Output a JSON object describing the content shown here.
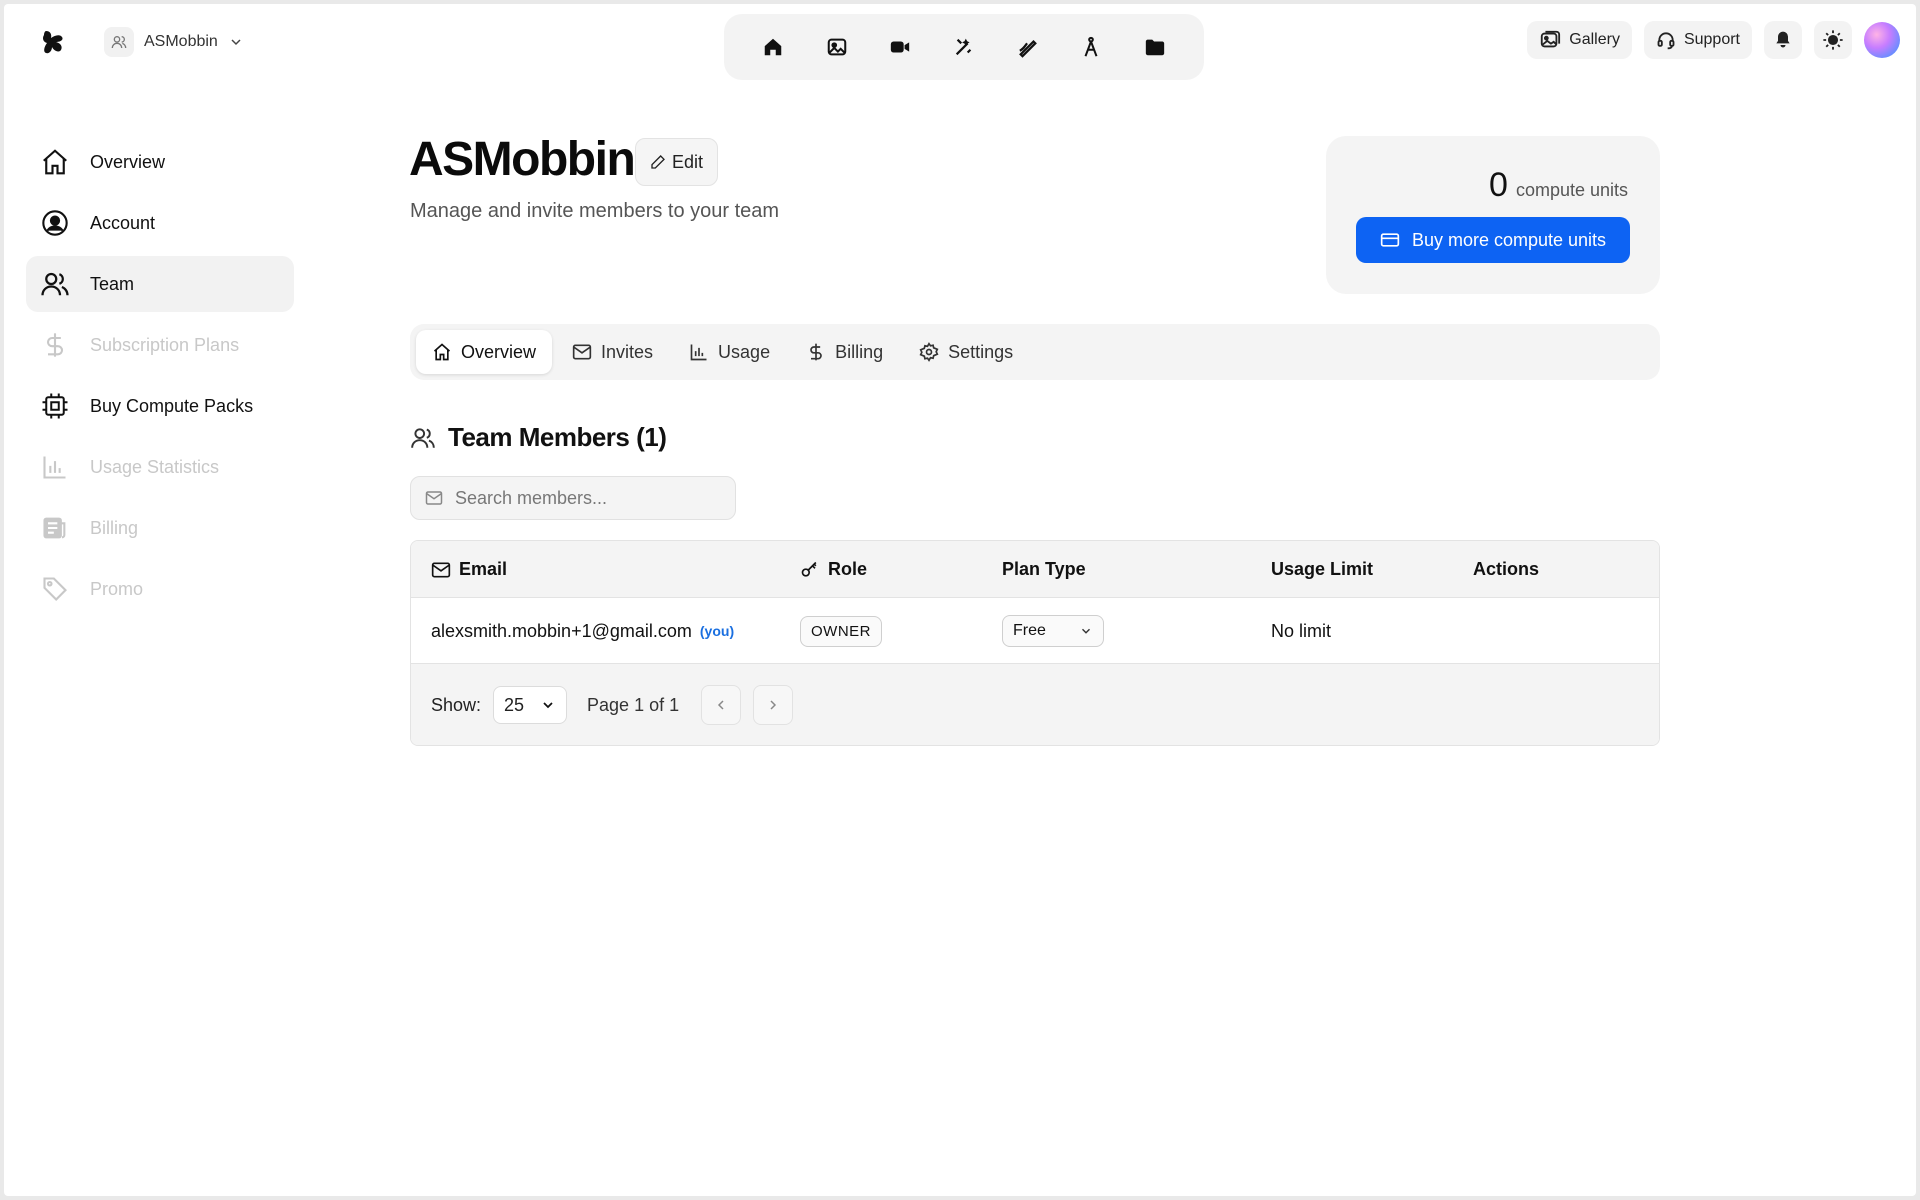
{
  "workspace": {
    "name": "ASMobbin"
  },
  "toolbar": {
    "tools": [
      "home-icon",
      "image-icon",
      "video-icon",
      "magic-wand-icon",
      "pen-icon",
      "compass-icon",
      "folder-icon"
    ]
  },
  "topbar": {
    "gallery_label": "Gallery",
    "support_label": "Support"
  },
  "sidebar": {
    "items": [
      {
        "label": "Overview",
        "icon": "home-icon",
        "state": "normal"
      },
      {
        "label": "Account",
        "icon": "user-circle-icon",
        "state": "normal"
      },
      {
        "label": "Team",
        "icon": "users-icon",
        "state": "active"
      },
      {
        "label": "Subscription Plans",
        "icon": "dollar-icon",
        "state": "disabled"
      },
      {
        "label": "Buy Compute Packs",
        "icon": "cpu-icon",
        "state": "normal"
      },
      {
        "label": "Usage Statistics",
        "icon": "bar-chart-icon",
        "state": "disabled"
      },
      {
        "label": "Billing",
        "icon": "receipt-icon",
        "state": "disabled"
      },
      {
        "label": "Promo",
        "icon": "tag-icon",
        "state": "disabled"
      }
    ]
  },
  "header": {
    "title": "ASMobbin",
    "edit_label": "Edit",
    "subtitle": "Manage and invite members to your team"
  },
  "units": {
    "count": "0",
    "label": "compute units",
    "buy_label": "Buy more compute units",
    "accent": "#0d63f3"
  },
  "tabs": [
    {
      "label": "Overview",
      "icon": "home-icon",
      "active": true
    },
    {
      "label": "Invites",
      "icon": "mail-icon",
      "active": false
    },
    {
      "label": "Usage",
      "icon": "bar-chart-icon",
      "active": false
    },
    {
      "label": "Billing",
      "icon": "dollar-icon",
      "active": false
    },
    {
      "label": "Settings",
      "icon": "gear-icon",
      "active": false
    }
  ],
  "members": {
    "title": "Team Members (1)",
    "search_placeholder": "Search members...",
    "columns": {
      "email": "Email",
      "role": "Role",
      "plan": "Plan Type",
      "limit": "Usage Limit",
      "actions": "Actions"
    },
    "rows": [
      {
        "email": "alexsmith.mobbin+1@gmail.com",
        "you": "(you)",
        "role": "OWNER",
        "plan": "Free",
        "limit": "No limit"
      }
    ],
    "footer": {
      "show_label": "Show:",
      "page_size": "25",
      "page_text": "Page 1 of 1"
    }
  }
}
